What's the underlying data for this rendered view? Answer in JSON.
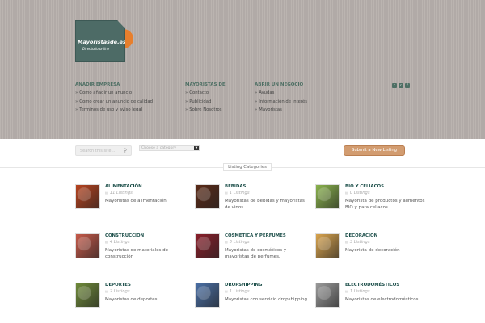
{
  "logo": {
    "title": "Mayoristasde.es",
    "subtitle": "Directorio online"
  },
  "nav": [
    {
      "heading": "AÑADIR EMPRESA",
      "items": [
        "Como añadir un anuncio",
        "Como crear un anuncio de calidad",
        "Terminos de uso y aviso legal"
      ]
    },
    {
      "heading": "MAYORISTAS DE",
      "items": [
        "Contacto",
        "Publicidad",
        "Sobre Nosotros"
      ]
    },
    {
      "heading": "ABRIR UN NEGOCIO",
      "items": [
        "Ayudas",
        "Información de interés",
        "Mayoristas"
      ]
    }
  ],
  "social": {
    "twitter_icon": "t",
    "rss_icon": "r",
    "facebook_icon": "f"
  },
  "search": {
    "placeholder": "Search this site...",
    "icon": "search-icon"
  },
  "category_select": {
    "value": "Choose a category"
  },
  "submit_label": "Submit a New Listing",
  "section_title": "Listing Categories",
  "categories": [
    {
      "name": "ALIMENTACIÓN",
      "count": "11 Listings",
      "desc": "Mayoristas de alimentación",
      "color": "#b7431f"
    },
    {
      "name": "BEBIDAS",
      "count": "1 Listings",
      "desc": "Mayoristas de bebidas y mayoristas de vinos",
      "color": "#5b2a17"
    },
    {
      "name": "BIO Y CELIACOS",
      "count": "0 Listings",
      "desc": "Mayorista de productos y alimentos BIO y para celiacos",
      "color": "#8ab34d"
    },
    {
      "name": "CONSTRUCCIÓN",
      "count": "4 Listings",
      "desc": "Mayoristas de materiales de construcción",
      "color": "#c65a4a"
    },
    {
      "name": "COSMÉTICA Y PERFUMES",
      "count": "5 Listings",
      "desc": "Mayoristas de cosméticos y mayoristas de perfumes.",
      "color": "#8a1f2a"
    },
    {
      "name": "DECORACIÓN",
      "count": "3 Listings",
      "desc": "Mayorista de decoración",
      "color": "#d9a44e"
    },
    {
      "name": "DEPORTES",
      "count": "2 Listings",
      "desc": "Mayoristas de deportes",
      "color": "#6f8a3a"
    },
    {
      "name": "DROPSHIPPING",
      "count": "1 Listings",
      "desc": "Mayoristas con servicio dropshipping",
      "color": "#4a6fa5"
    },
    {
      "name": "ELECTRODOMÉSTICOS",
      "count": "1 Listings",
      "desc": "Mayoristas de electrodomésticos",
      "color": "#9a9a9a"
    }
  ]
}
